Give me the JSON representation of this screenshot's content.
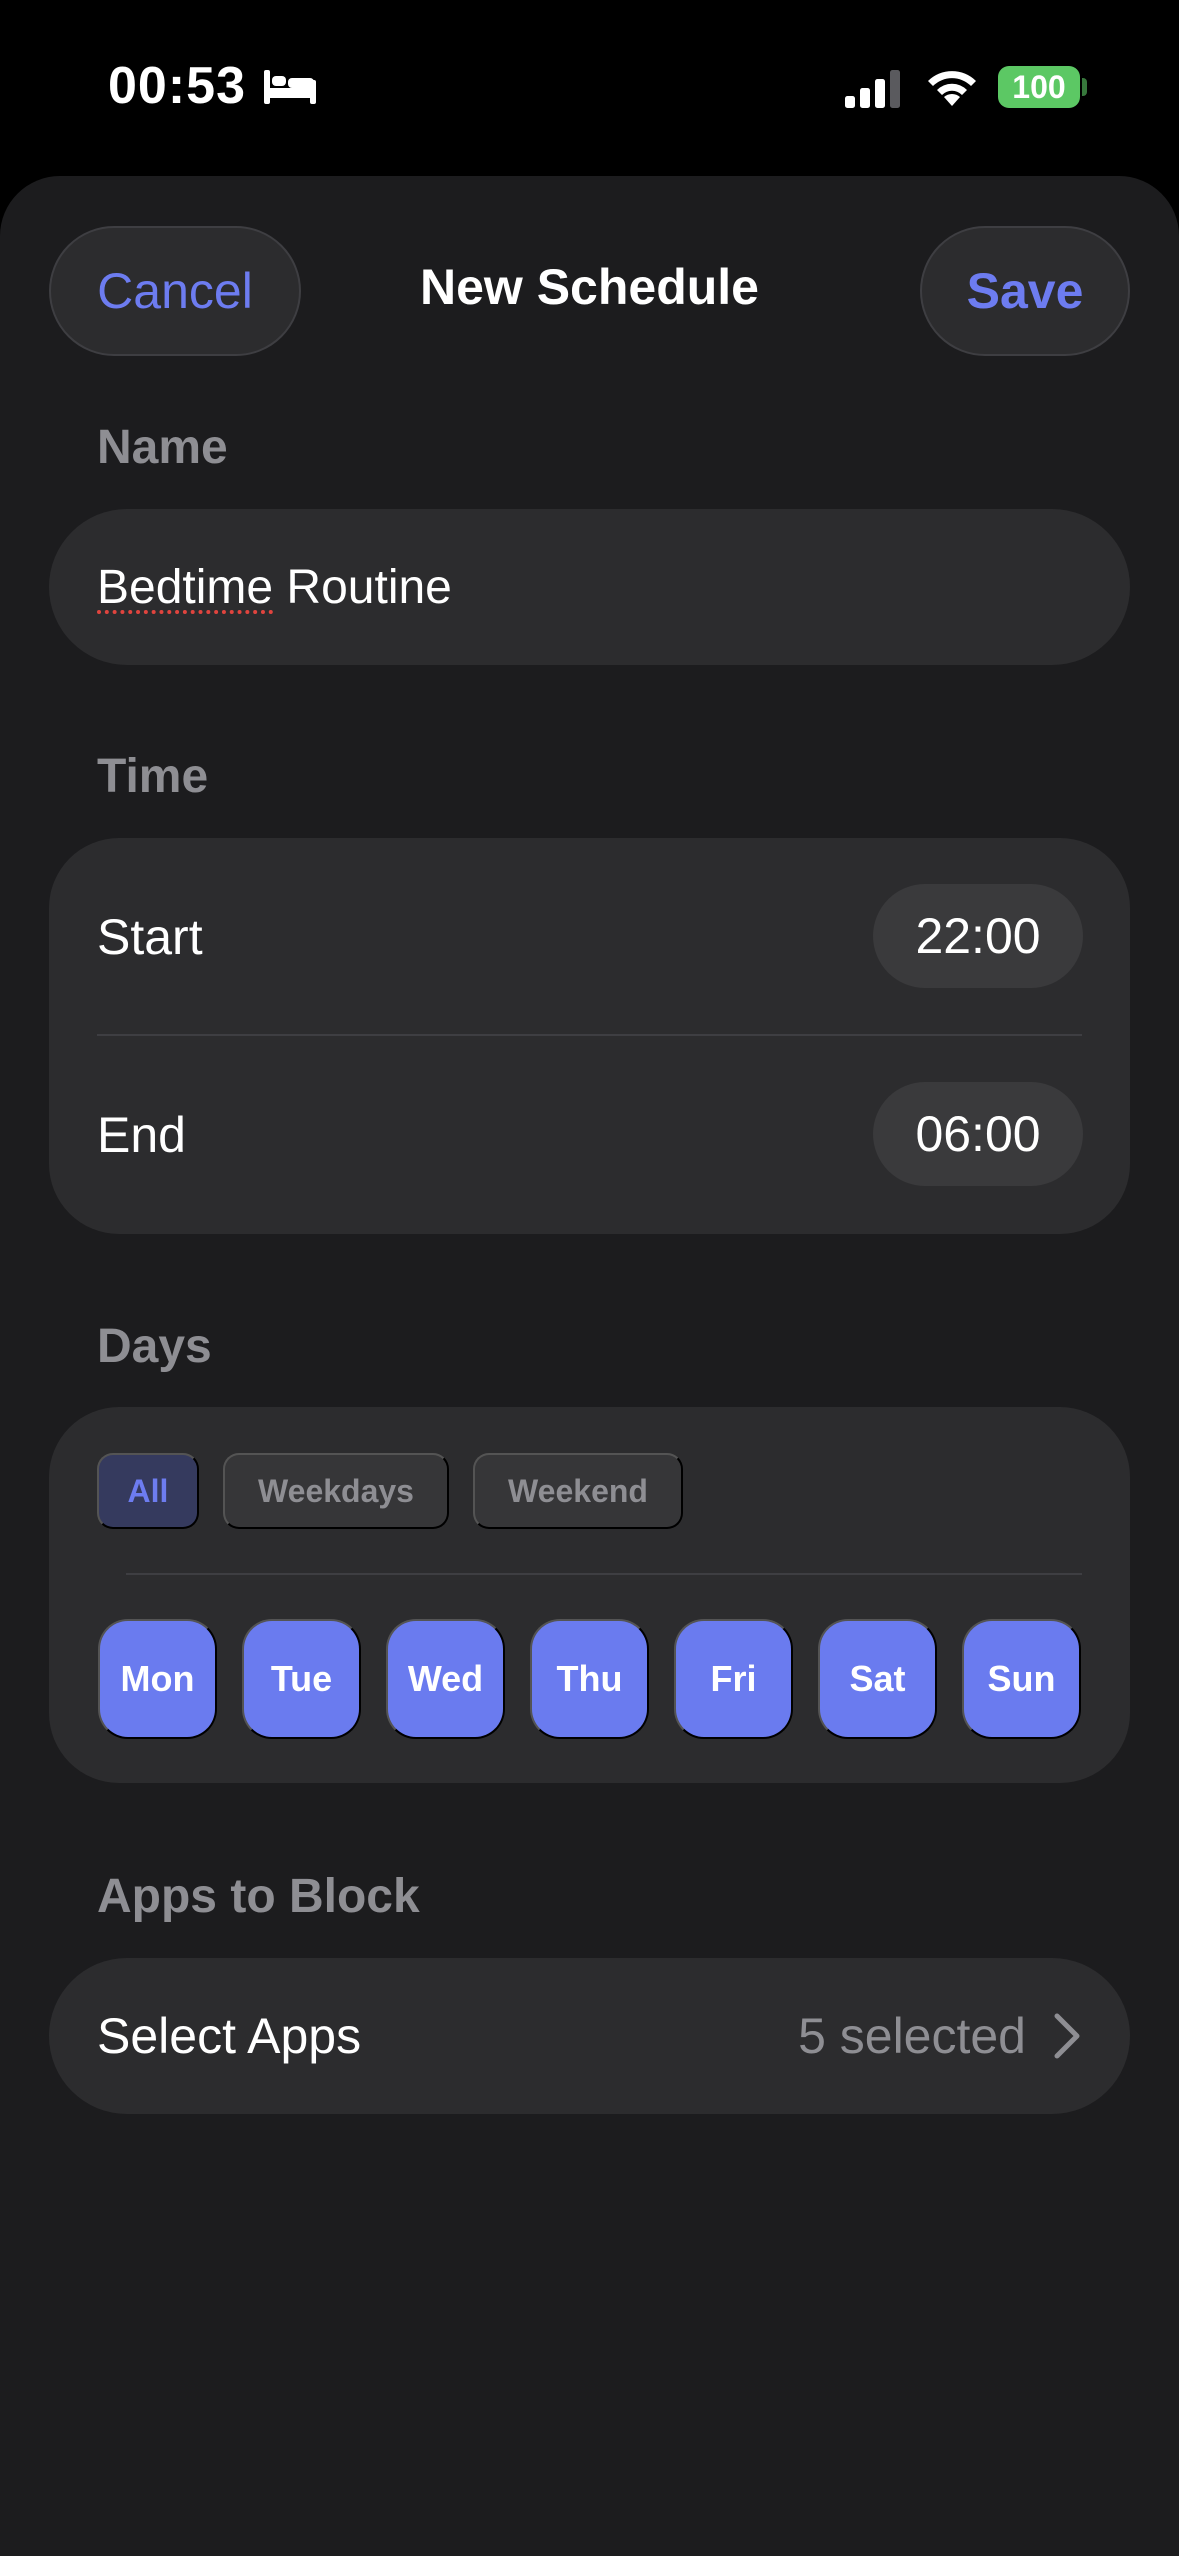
{
  "status_bar": {
    "time": "00:53",
    "focus_icon": "bed-icon",
    "signal_icon": "cellular-signal-icon",
    "wifi_icon": "wifi-icon",
    "battery": "100"
  },
  "nav": {
    "cancel_label": "Cancel",
    "title": "New Schedule",
    "save_label": "Save"
  },
  "name_section": {
    "label": "Name",
    "value_misspelled": "Bedtime",
    "value_rest": " Routine"
  },
  "time_section": {
    "label": "Time",
    "start_label": "Start",
    "start_value": "22:00",
    "end_label": "End",
    "end_value": "06:00"
  },
  "days_section": {
    "label": "Days",
    "presets": [
      {
        "label": "All",
        "selected": true
      },
      {
        "label": "Weekdays",
        "selected": false
      },
      {
        "label": "Weekend",
        "selected": false
      }
    ],
    "days": [
      {
        "label": "Mon",
        "selected": true
      },
      {
        "label": "Tue",
        "selected": true
      },
      {
        "label": "Wed",
        "selected": true
      },
      {
        "label": "Thu",
        "selected": true
      },
      {
        "label": "Fri",
        "selected": true
      },
      {
        "label": "Sat",
        "selected": true
      },
      {
        "label": "Sun",
        "selected": true
      }
    ]
  },
  "apps_section": {
    "label": "Apps to Block",
    "select_label": "Select Apps",
    "count_text": "5 selected",
    "chevron_icon": "chevron-right-icon"
  },
  "colors": {
    "accent": "#6a7bef",
    "background": "#1c1c1e",
    "card": "#2c2c2e",
    "secondary_text": "#8e8e93",
    "battery": "#5cc864"
  }
}
